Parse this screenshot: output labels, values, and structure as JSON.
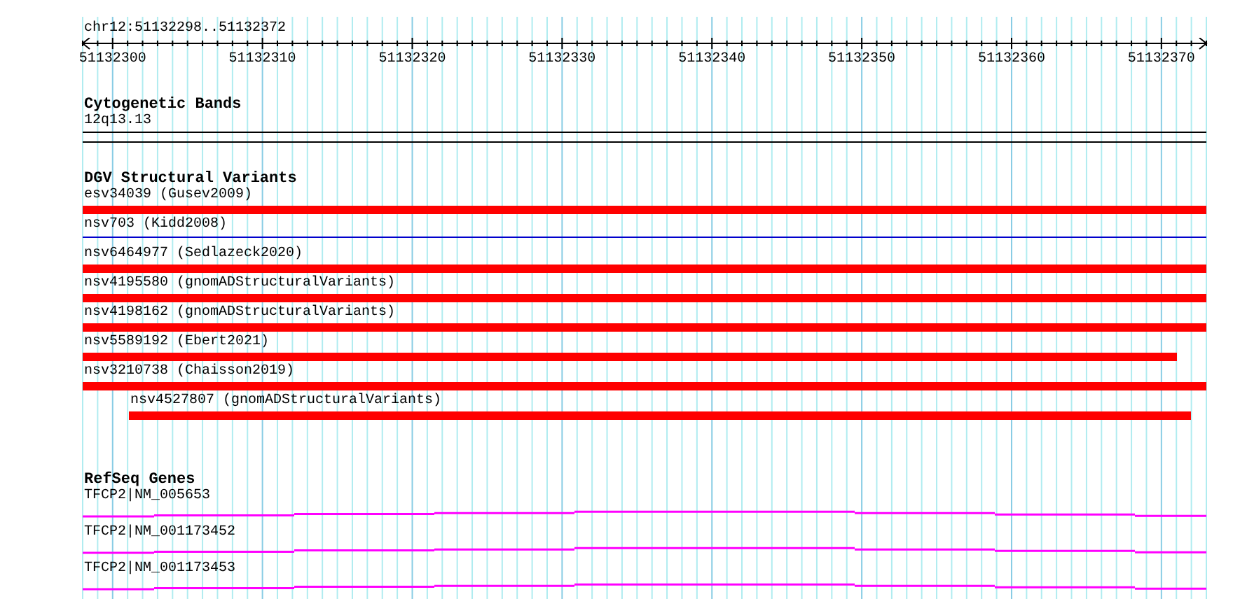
{
  "ruler": {
    "location": "chr12:51132298..51132372",
    "tick_labels": [
      "51132300",
      "51132310",
      "51132320",
      "51132330",
      "51132340",
      "51132350",
      "51132360",
      "51132370"
    ]
  },
  "cytogenetic_bands": {
    "title": "Cytogenetic Bands",
    "band": "12q13.13"
  },
  "dgv_structural_variants": {
    "title": "DGV Structural Variants",
    "features": [
      {
        "label": "esv34039 (Gusev2009)",
        "kind": "bar"
      },
      {
        "label": "nsv703 (Kidd2008)",
        "kind": "line"
      },
      {
        "label": "nsv6464977 (Sedlazeck2020)",
        "kind": "bar"
      },
      {
        "label": "nsv4195580 (gnomADStructuralVariants)",
        "kind": "bar"
      },
      {
        "label": "nsv4198162 (gnomADStructuralVariants)",
        "kind": "bar"
      },
      {
        "label": "nsv5589192 (Ebert2021)",
        "kind": "bar"
      },
      {
        "label": "nsv3210738 (Chaisson2019)",
        "kind": "bar"
      },
      {
        "label": "nsv4527807 (gnomADStructuralVariants)",
        "kind": "bar"
      }
    ]
  },
  "refseq_genes": {
    "title": "RefSeq Genes",
    "features": [
      {
        "label": "TFCP2|NM_005653"
      },
      {
        "label": "TFCP2|NM_001173452"
      },
      {
        "label": "TFCP2|NM_001173453"
      }
    ]
  }
}
